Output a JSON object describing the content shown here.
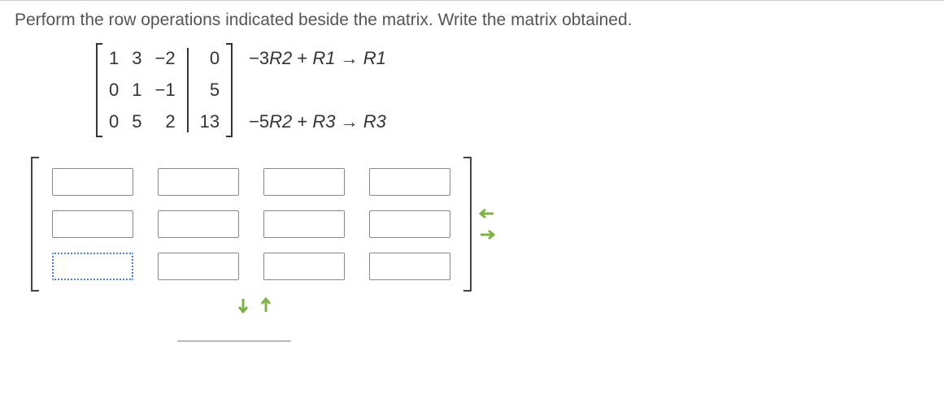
{
  "question": "Perform the row operations indicated beside the matrix. Write the matrix obtained.",
  "matrix": {
    "rows": [
      {
        "c0": "1",
        "c1": "3",
        "c2": "−2",
        "aug": "0"
      },
      {
        "c0": "0",
        "c1": "1",
        "c2": "−1",
        "aug": "5"
      },
      {
        "c0": "0",
        "c1": "5",
        "c2": "2",
        "aug": "13"
      }
    ]
  },
  "operations": {
    "op1": {
      "coef": "−3",
      "r_a": "R2",
      "plus": " + ",
      "r_b": "R1",
      "arrow": " → ",
      "r_c": "R1"
    },
    "op2": {
      "coef": "−5",
      "r_a": "R2",
      "plus": " + ",
      "r_b": "R3",
      "arrow": " → ",
      "r_c": "R3"
    }
  },
  "answer_grid": {
    "rows": 3,
    "cols": 4
  },
  "chart_data": {
    "type": "table",
    "title": "Augmented matrix with row operations",
    "matrix": [
      [
        1,
        3,
        -2,
        0
      ],
      [
        0,
        1,
        -1,
        5
      ],
      [
        0,
        5,
        2,
        13
      ]
    ],
    "augmented_column_index": 3,
    "row_operations": [
      "R1 ← −3·R2 + R1",
      "R3 ← −5·R2 + R3"
    ]
  }
}
